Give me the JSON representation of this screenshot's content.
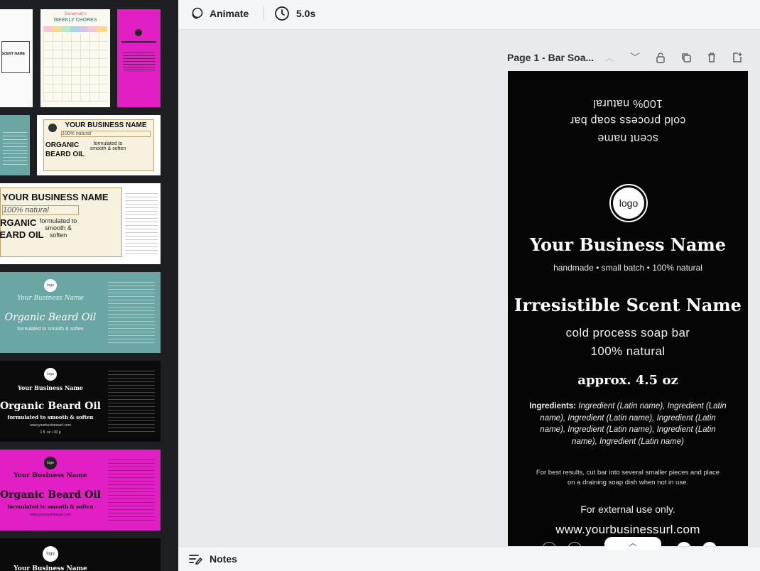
{
  "toolbar": {
    "animate_label": "Animate",
    "duration_label": "5.0s"
  },
  "page": {
    "title": "Page 1 - Bar Soa..."
  },
  "label": {
    "upside_lines": [
      "100% natural",
      "cold process soap bar",
      "scent name"
    ],
    "logo_text": "logo",
    "business_name": "Your Business Name",
    "tagline": "handmade • small batch • 100% natural",
    "scent_name": "Irresistible Scent Name",
    "product_line1": "cold process soap bar",
    "product_line2": "100% natural",
    "weight": "approx. 4.5 oz",
    "ingredients_heading": "Ingredients:",
    "ingredients_lines": [
      "Ingredient (Latin name), Ingredient (Latin",
      "name), Ingredient (Latin name), Ingredient (Latin",
      "name), Ingredient (Latin name), Ingredient (Latin",
      "name), Ingredient (Latin name)"
    ],
    "instructions_line1": "For best results, cut bar into several smaller pieces and place",
    "instructions_line2": "on a draining soap dish when not in use.",
    "external_use": "For external use only.",
    "url": "www.yourbusinessurl.com"
  },
  "templates": {
    "t_chores_title": "WEEKLY CHORES",
    "t_chores_name": "Savannah's",
    "t_business_name": "YOUR BUSINESS NAME",
    "t_scent_name": "SCENT NAME",
    "t_natural": "100% natural",
    "t_organic": "ORGANIC",
    "t_beard_oil": "BEARD OIL",
    "t_formulated": "formulated to smooth & soften",
    "t_cap_business": "Your Business Name",
    "t_cap_beard": "Organic Beard Oil",
    "t_cap_formulated": "formulated to smooth & soften",
    "t_url": "www.yourbusinessurl.com",
    "t_qty": "1 fl. oz • 30 g",
    "t_logo": "logo"
  },
  "bottom": {
    "notes_label": "Notes"
  },
  "colors": {
    "panel_bg": "#1d1f22",
    "label_bg": "#050505",
    "magenta": "#e21fc4",
    "teal": "#6aa6a4",
    "cream": "#f7f1df"
  }
}
